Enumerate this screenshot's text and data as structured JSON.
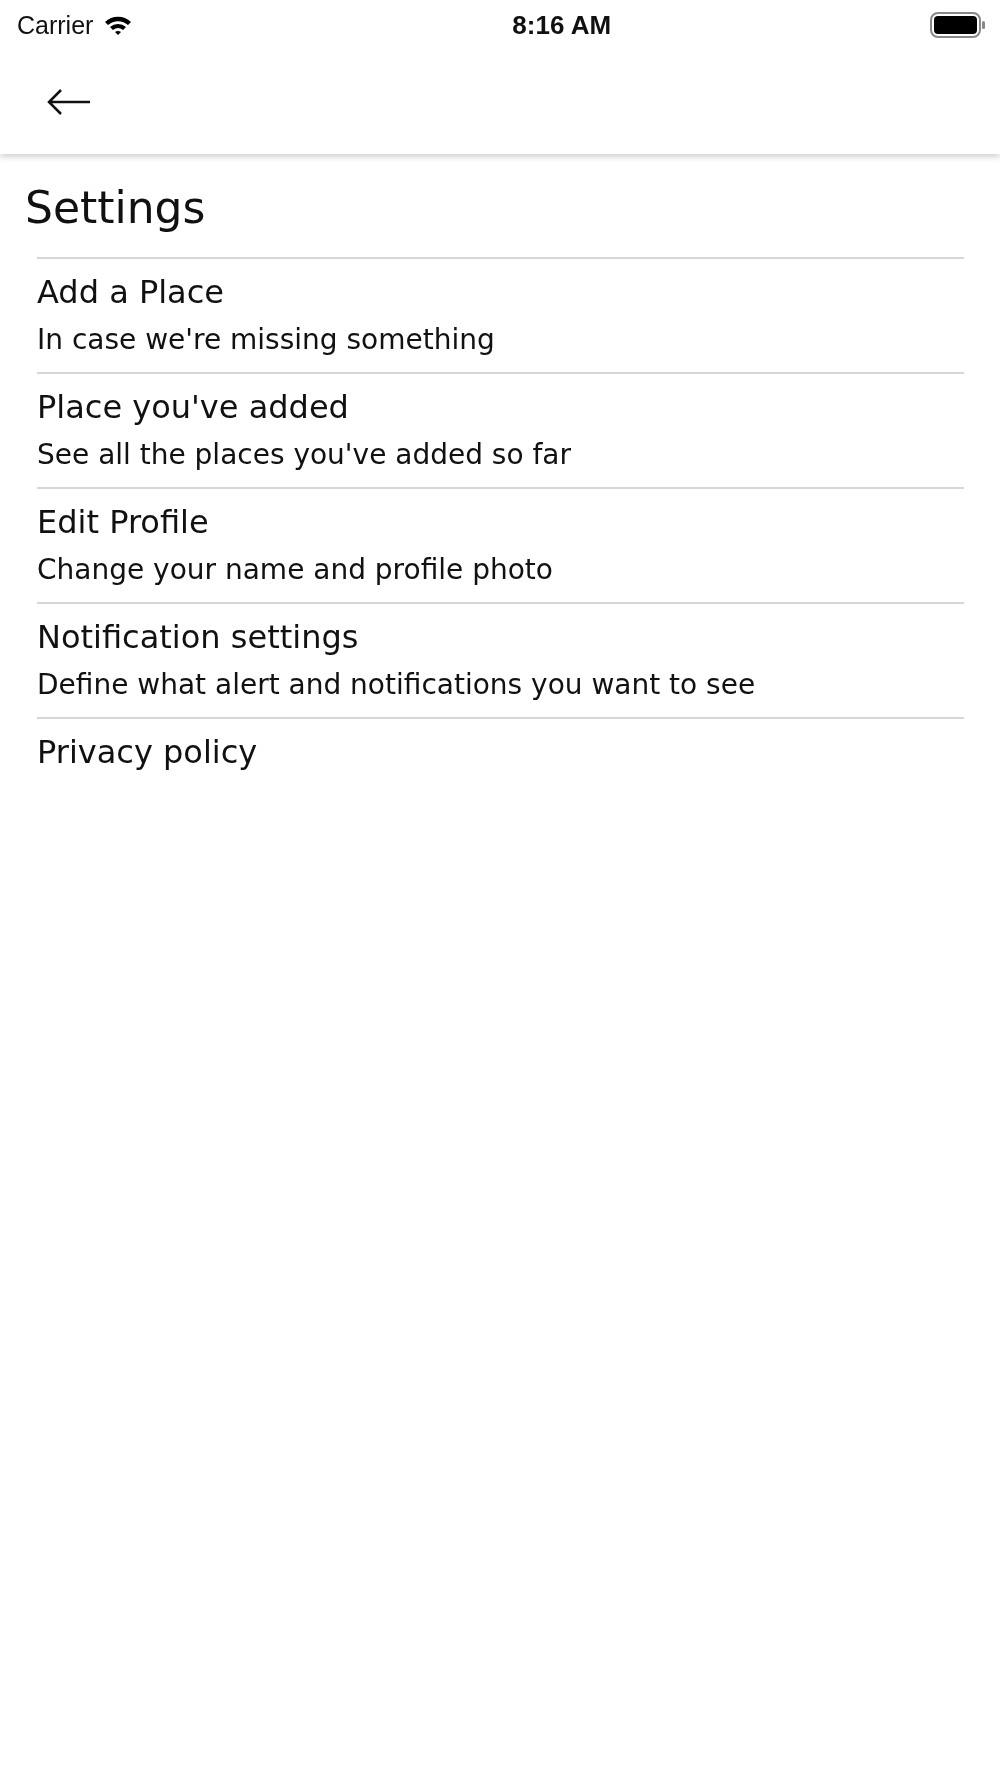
{
  "status_bar": {
    "carrier": "Carrier",
    "time": "8:16 AM"
  },
  "header": {
    "title": "Settings"
  },
  "items": [
    {
      "title": "Add a Place",
      "subtitle": "In case we're missing something"
    },
    {
      "title": "Place you've added",
      "subtitle": "See all the places you've added so far"
    },
    {
      "title": "Edit Profile",
      "subtitle": "Change your name and profile photo"
    },
    {
      "title": "Notification settings",
      "subtitle": "Define what alert and notifications you want to see"
    },
    {
      "title": "Privacy policy"
    }
  ]
}
